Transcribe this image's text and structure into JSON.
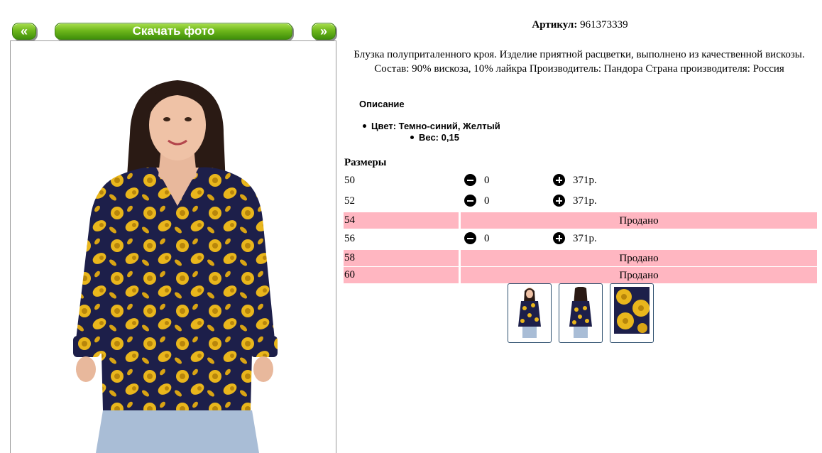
{
  "nav": {
    "prev_label": "«",
    "download_label": "Скачать фото",
    "next_label": "»"
  },
  "product": {
    "sku_label": "Артикул:",
    "sku_value": "961373339",
    "description": "Блузка полуприталенного кроя. Изделие приятной расцветки, выполнено из качественной вискозы. Состав: 90% вискоза, 10% лайкра Производитель: Пандора Страна производителя: Россия",
    "details_title": "Описание",
    "features": [
      "Цвет: Темно-синий, Желтый",
      "Вес: 0,15"
    ]
  },
  "sizes": {
    "title": "Размеры",
    "rows": [
      {
        "size": "50",
        "available": true,
        "qty": "0",
        "price": "371р."
      },
      {
        "size": "52",
        "available": true,
        "qty": "0",
        "price": "371р."
      },
      {
        "size": "54",
        "available": false,
        "status": "Продано"
      },
      {
        "size": "56",
        "available": true,
        "qty": "0",
        "price": "371р."
      },
      {
        "size": "58",
        "available": false,
        "status": "Продано"
      },
      {
        "size": "60",
        "available": false,
        "status": "Продано"
      }
    ]
  },
  "colors": {
    "button_green": "#6fb81c",
    "sold_bg": "#ffb6c1",
    "print_navy": "#1d1f4a",
    "print_yellow": "#e9b61c"
  },
  "icons": {
    "minus": "minus-circle-icon",
    "plus": "plus-circle-icon"
  }
}
